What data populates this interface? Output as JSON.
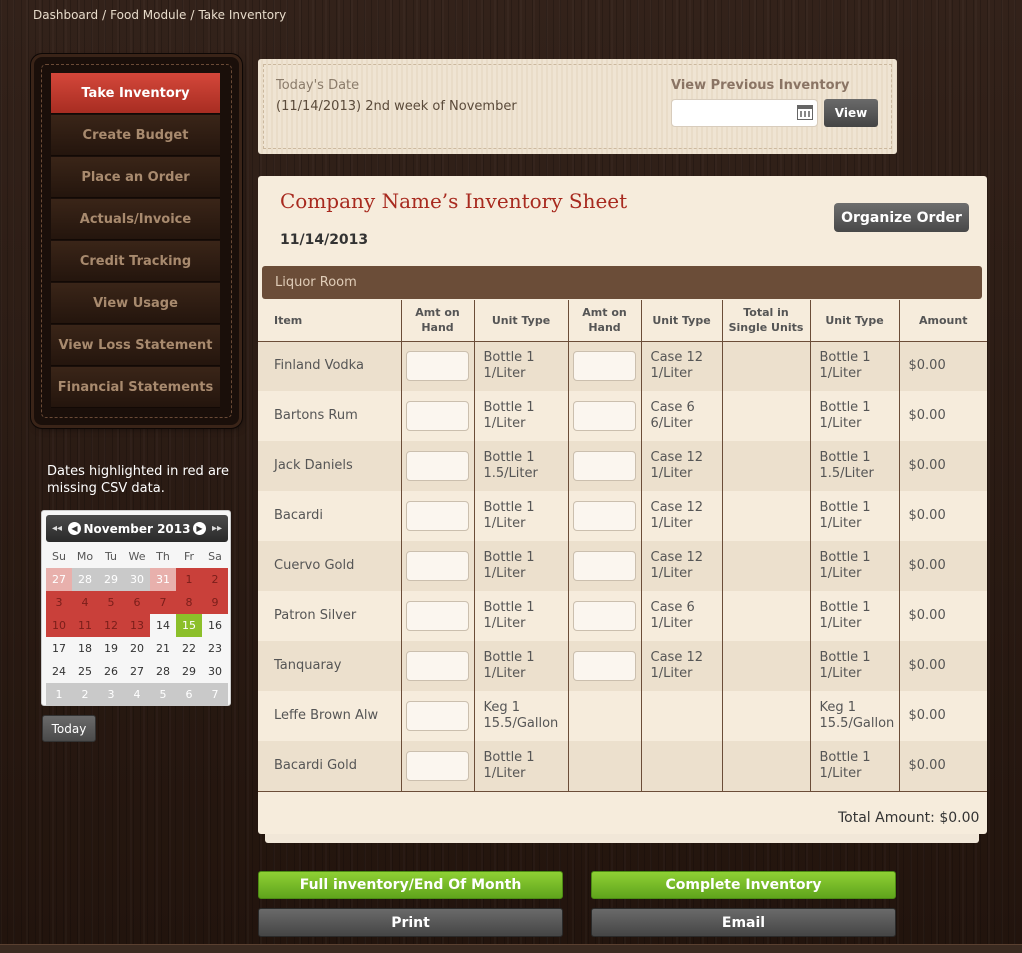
{
  "breadcrumb": [
    "Dashboard",
    "Food Module",
    "Take Inventory"
  ],
  "menu": [
    {
      "label": "Take Inventory",
      "active": true
    },
    {
      "label": "Create Budget"
    },
    {
      "label": "Place an Order"
    },
    {
      "label": "Actuals/Invoice"
    },
    {
      "label": "Credit Tracking"
    },
    {
      "label": "View Usage"
    },
    {
      "label": "View Loss Statement"
    },
    {
      "label": "Financial Statements"
    }
  ],
  "calendar": {
    "note": "Dates highlighted in red are missing CSV data.",
    "month_label": "November 2013",
    "prev_year": "◂◂",
    "next_year": "▸▸",
    "prev_month": "◀",
    "next_month": "▶",
    "dow": [
      "Su",
      "Mo",
      "Tu",
      "We",
      "Th",
      "Fr",
      "Sa"
    ],
    "weeks": [
      [
        {
          "d": "27",
          "t": "other-red"
        },
        {
          "d": "28",
          "t": "other"
        },
        {
          "d": "29",
          "t": "other"
        },
        {
          "d": "30",
          "t": "other"
        },
        {
          "d": "31",
          "t": "other-red"
        },
        {
          "d": "1",
          "t": "red"
        },
        {
          "d": "2",
          "t": "red"
        }
      ],
      [
        {
          "d": "3",
          "t": "red"
        },
        {
          "d": "4",
          "t": "red"
        },
        {
          "d": "5",
          "t": "red"
        },
        {
          "d": "6",
          "t": "red"
        },
        {
          "d": "7",
          "t": "red"
        },
        {
          "d": "8",
          "t": "red"
        },
        {
          "d": "9",
          "t": "red"
        }
      ],
      [
        {
          "d": "10",
          "t": "red"
        },
        {
          "d": "11",
          "t": "red"
        },
        {
          "d": "12",
          "t": "red"
        },
        {
          "d": "13",
          "t": "red"
        },
        {
          "d": "14",
          "t": ""
        },
        {
          "d": "15",
          "t": "today"
        },
        {
          "d": "16",
          "t": ""
        }
      ],
      [
        {
          "d": "17",
          "t": ""
        },
        {
          "d": "18",
          "t": ""
        },
        {
          "d": "19",
          "t": ""
        },
        {
          "d": "20",
          "t": ""
        },
        {
          "d": "21",
          "t": ""
        },
        {
          "d": "22",
          "t": ""
        },
        {
          "d": "23",
          "t": ""
        }
      ],
      [
        {
          "d": "24",
          "t": ""
        },
        {
          "d": "25",
          "t": ""
        },
        {
          "d": "26",
          "t": ""
        },
        {
          "d": "27",
          "t": ""
        },
        {
          "d": "28",
          "t": ""
        },
        {
          "d": "29",
          "t": ""
        },
        {
          "d": "30",
          "t": ""
        }
      ],
      [
        {
          "d": "1",
          "t": "other"
        },
        {
          "d": "2",
          "t": "other"
        },
        {
          "d": "3",
          "t": "other"
        },
        {
          "d": "4",
          "t": "other"
        },
        {
          "d": "5",
          "t": "other"
        },
        {
          "d": "6",
          "t": "other"
        },
        {
          "d": "7",
          "t": "other"
        }
      ]
    ],
    "today_button": "Today"
  },
  "date_panel": {
    "todays_date_label": "Today's Date",
    "todays_date_value": "(11/14/2013) 2nd week of November",
    "view_previous_label": "View Previous Inventory",
    "view_previous_value": "",
    "view_button": "View"
  },
  "sheet": {
    "title": "Company Name’s Inventory Sheet",
    "date": "11/14/2013",
    "organize_button": "Organize Order",
    "section": "Liquor Room",
    "columns": [
      "Item",
      "Amt on Hand",
      "Unit Type",
      "Amt on Hand",
      "Unit Type",
      "Total in Single Units",
      "Unit Type",
      "Amount"
    ],
    "rows": [
      {
        "item": "Finland Vodka",
        "unit1": "Bottle 1 1/Liter",
        "has_amt2": true,
        "unit2": "Case 12 1/Liter",
        "total": "",
        "unit3": "Bottle 1 1/Liter",
        "amount": "$0.00"
      },
      {
        "item": "Bartons Rum",
        "unit1": "Bottle 1 1/Liter",
        "has_amt2": true,
        "unit2": "Case 6 6/Liter",
        "total": "",
        "unit3": "Bottle 1 1/Liter",
        "amount": "$0.00"
      },
      {
        "item": "Jack Daniels",
        "unit1": "Bottle 1 1.5/Liter",
        "has_amt2": true,
        "unit2": "Case 12 1/Liter",
        "total": "",
        "unit3": "Bottle 1 1.5/Liter",
        "amount": "$0.00"
      },
      {
        "item": "Bacardi",
        "unit1": "Bottle 1 1/Liter",
        "has_amt2": true,
        "unit2": "Case 12 1/Liter",
        "total": "",
        "unit3": "Bottle 1 1/Liter",
        "amount": "$0.00"
      },
      {
        "item": "Cuervo Gold",
        "unit1": "Bottle 1 1/Liter",
        "has_amt2": true,
        "unit2": "Case 12 1/Liter",
        "total": "",
        "unit3": "Bottle 1 1/Liter",
        "amount": "$0.00"
      },
      {
        "item": "Patron Silver",
        "unit1": "Bottle 1 1/Liter",
        "has_amt2": true,
        "unit2": "Case 6 1/Liter",
        "total": "",
        "unit3": "Bottle 1 1/Liter",
        "amount": "$0.00"
      },
      {
        "item": "Tanquaray",
        "unit1": "Bottle 1 1/Liter",
        "has_amt2": true,
        "unit2": "Case 12 1/Liter",
        "total": "",
        "unit3": "Bottle 1 1/Liter",
        "amount": "$0.00"
      },
      {
        "item": "Leffe Brown Alw",
        "unit1": "Keg 1 15.5/Gallon",
        "has_amt2": false,
        "unit2": "",
        "total": "",
        "unit3": "Keg 1 15.5/Gallon",
        "amount": "$0.00"
      },
      {
        "item": "Bacardi Gold",
        "unit1": "Bottle 1 1/Liter",
        "has_amt2": false,
        "unit2": "",
        "total": "",
        "unit3": "Bottle 1 1/Liter",
        "amount": "$0.00"
      }
    ],
    "total_amount": "Total Amount: $0.00"
  },
  "actions": {
    "full_inventory": "Full inventory/End Of Month",
    "complete_inventory": "Complete Inventory",
    "print": "Print",
    "email": "Email"
  },
  "colors": {
    "accent_red": "#c9403a",
    "green": "#8cbf2a",
    "brown": "#6b4d38"
  }
}
